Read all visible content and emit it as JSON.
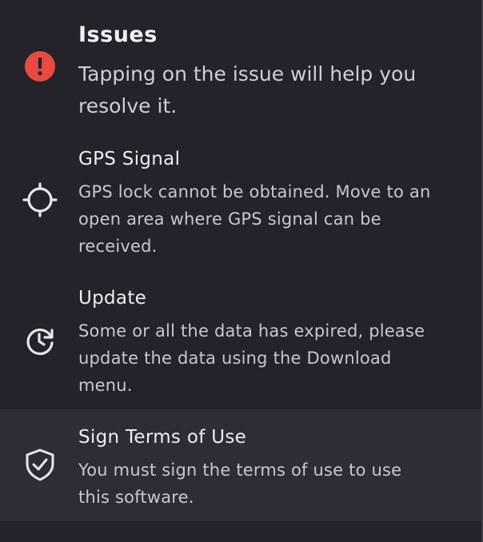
{
  "header": {
    "title": "Issues",
    "subtitle": "Tapping on the issue will help you resolve it.",
    "icon": "alert-icon",
    "accent": "#e84a3f"
  },
  "issues": [
    {
      "title": "GPS Signal",
      "description": "GPS lock cannot be obtained. Move to an open area where GPS signal can be received.",
      "icon": "crosshair-icon"
    },
    {
      "title": "Update",
      "description": "Some or all the data has expired, please update the data using the Download menu.",
      "icon": "clock-refresh-icon"
    },
    {
      "title": "Sign Terms of Use",
      "description": "You must sign the terms of use to use this software.",
      "icon": "shield-check-icon"
    }
  ]
}
